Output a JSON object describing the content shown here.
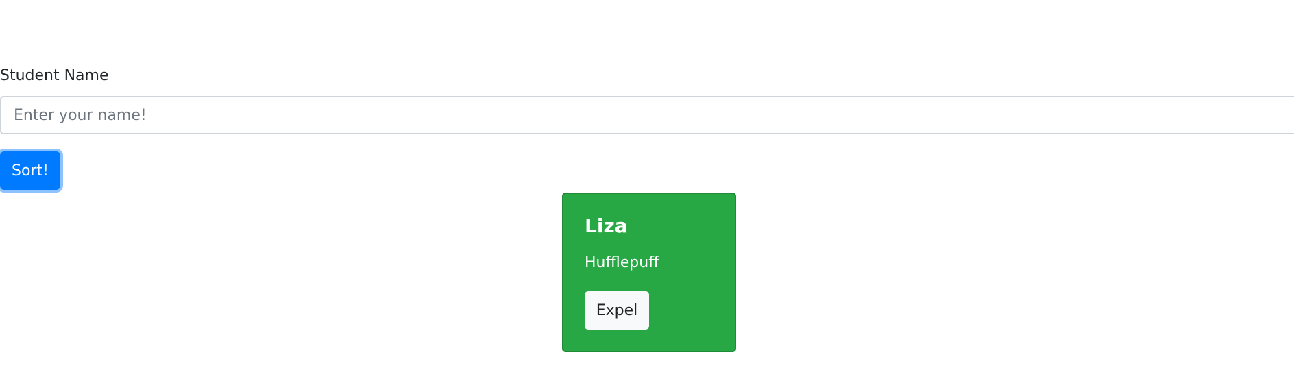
{
  "form": {
    "label": "Student Name",
    "input_value": "",
    "input_placeholder": "Enter your name!",
    "submit_label": "Sort!"
  },
  "students": [
    {
      "name": "Liza",
      "house": "Hufflepuff",
      "expel_label": "Expel"
    }
  ],
  "colors": {
    "primary": "#007bff",
    "card_hufflepuff": "#28a745",
    "light_button": "#f8f9fa",
    "input_border": "#ced4da"
  }
}
